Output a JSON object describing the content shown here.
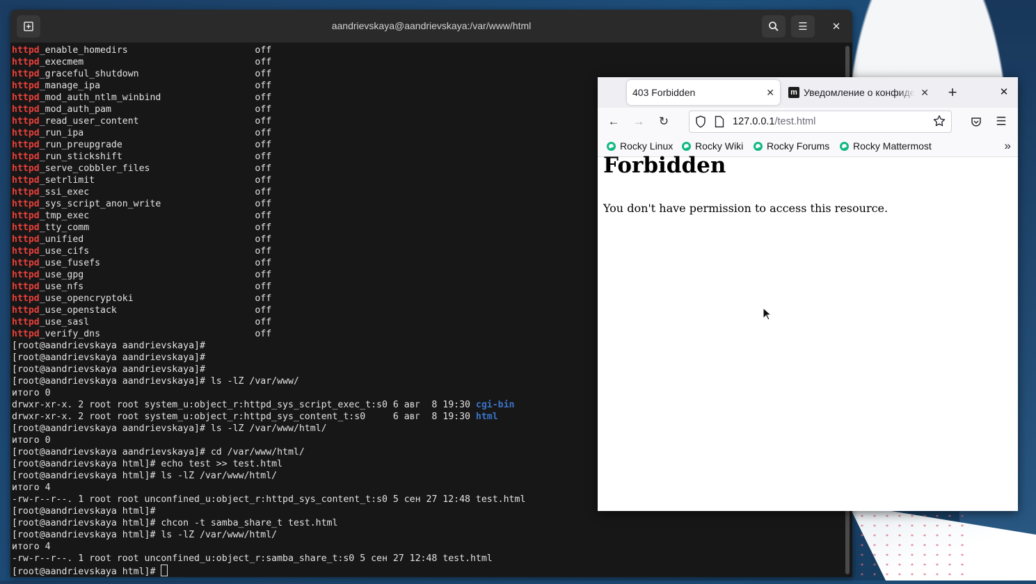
{
  "terminal": {
    "title": "aandrievskaya@aandrievskaya:/var/www/html",
    "booleans": [
      {
        "prefix": "httpd",
        "suffix": "_enable_homedirs",
        "value": "off"
      },
      {
        "prefix": "httpd",
        "suffix": "_execmem",
        "value": "off"
      },
      {
        "prefix": "httpd",
        "suffix": "_graceful_shutdown",
        "value": "off"
      },
      {
        "prefix": "httpd",
        "suffix": "_manage_ipa",
        "value": "off"
      },
      {
        "prefix": "httpd",
        "suffix": "_mod_auth_ntlm_winbind",
        "value": "off"
      },
      {
        "prefix": "httpd",
        "suffix": "_mod_auth_pam",
        "value": "off"
      },
      {
        "prefix": "httpd",
        "suffix": "_read_user_content",
        "value": "off"
      },
      {
        "prefix": "httpd",
        "suffix": "_run_ipa",
        "value": "off"
      },
      {
        "prefix": "httpd",
        "suffix": "_run_preupgrade",
        "value": "off"
      },
      {
        "prefix": "httpd",
        "suffix": "_run_stickshift",
        "value": "off"
      },
      {
        "prefix": "httpd",
        "suffix": "_serve_cobbler_files",
        "value": "off"
      },
      {
        "prefix": "httpd",
        "suffix": "_setrlimit",
        "value": "off"
      },
      {
        "prefix": "httpd",
        "suffix": "_ssi_exec",
        "value": "off"
      },
      {
        "prefix": "httpd",
        "suffix": "_sys_script_anon_write",
        "value": "off"
      },
      {
        "prefix": "httpd",
        "suffix": "_tmp_exec",
        "value": "off"
      },
      {
        "prefix": "httpd",
        "suffix": "_tty_comm",
        "value": "off"
      },
      {
        "prefix": "httpd",
        "suffix": "_unified",
        "value": "off"
      },
      {
        "prefix": "httpd",
        "suffix": "_use_cifs",
        "value": "off"
      },
      {
        "prefix": "httpd",
        "suffix": "_use_fusefs",
        "value": "off"
      },
      {
        "prefix": "httpd",
        "suffix": "_use_gpg",
        "value": "off"
      },
      {
        "prefix": "httpd",
        "suffix": "_use_nfs",
        "value": "off"
      },
      {
        "prefix": "httpd",
        "suffix": "_use_opencryptoki",
        "value": "off"
      },
      {
        "prefix": "httpd",
        "suffix": "_use_openstack",
        "value": "off"
      },
      {
        "prefix": "httpd",
        "suffix": "_use_sasl",
        "value": "off"
      },
      {
        "prefix": "httpd",
        "suffix": "_verify_dns",
        "value": "off"
      }
    ],
    "lines": [
      {
        "text": "[root@aandrievskaya aandrievskaya]#"
      },
      {
        "text": "[root@aandrievskaya aandrievskaya]#"
      },
      {
        "text": "[root@aandrievskaya aandrievskaya]#"
      },
      {
        "text": "[root@aandrievskaya aandrievskaya]# ls -lZ /var/www/"
      },
      {
        "text": "итого 0"
      },
      {
        "text": "drwxr-xr-x. 2 root root system_u:object_r:httpd_sys_script_exec_t:s0 6 авг  8 19:30 ",
        "link": "cgi-bin"
      },
      {
        "text": "drwxr-xr-x. 2 root root system_u:object_r:httpd_sys_content_t:s0     6 авг  8 19:30 ",
        "link": "html"
      },
      {
        "text": "[root@aandrievskaya aandrievskaya]# ls -lZ /var/www/html/"
      },
      {
        "text": "итого 0"
      },
      {
        "text": "[root@aandrievskaya aandrievskaya]# cd /var/www/html/"
      },
      {
        "text": "[root@aandrievskaya html]# echo test >> test.html"
      },
      {
        "text": "[root@aandrievskaya html]# ls -lZ /var/www/html/"
      },
      {
        "text": "итого 4"
      },
      {
        "text": "-rw-r--r--. 1 root root unconfined_u:object_r:httpd_sys_content_t:s0 5 сен 27 12:48 test.html"
      },
      {
        "text": "[root@aandrievskaya html]#"
      },
      {
        "text": "[root@aandrievskaya html]# chcon -t samba_share_t test.html"
      },
      {
        "text": "[root@aandrievskaya html]# ls -lZ /var/www/html/"
      },
      {
        "text": "итого 4"
      },
      {
        "text": "-rw-r--r--. 1 root root unconfined_u:object_r:samba_share_t:s0 5 сен 27 12:48 test.html"
      },
      {
        "text": "[root@aandrievskaya html]# ",
        "cursor": true
      }
    ]
  },
  "browser": {
    "tabs": [
      {
        "label": "403 Forbidden",
        "active": true
      },
      {
        "label": "Уведомление о конфиденциальности",
        "active": false,
        "favicon": "m"
      }
    ],
    "url": {
      "host": "127.0.0.1",
      "path": "/test.html"
    },
    "bookmarks": [
      "Rocky Linux",
      "Rocky Wiki",
      "Rocky Forums",
      "Rocky Mattermost"
    ],
    "page": {
      "heading": "Forbidden",
      "message": "You don't have permission to access this resource."
    }
  }
}
